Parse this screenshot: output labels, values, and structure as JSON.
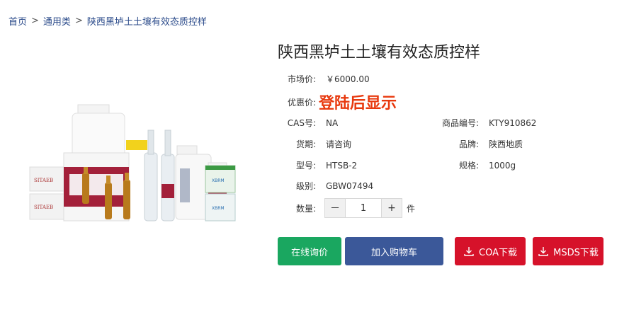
{
  "breadcrumb": {
    "items": [
      "首页",
      "通用类",
      "陕西黑垆土土壤有效态质控样"
    ],
    "separator": ">"
  },
  "product": {
    "title": "陕西黑垆土土壤有效态质控样",
    "market_price_label": "市场价:",
    "market_price_value": "￥6000.00",
    "promo_label": "优惠价:",
    "promo_value": "登陆后显示",
    "cas_label": "CAS号:",
    "cas_value": "NA",
    "code_label": "商品编号:",
    "code_value": "KTY910862",
    "delivery_label": "货期:",
    "delivery_value": "请咨询",
    "brand_label": "品牌:",
    "brand_value": "陕西地质",
    "model_label": "型号:",
    "model_value": "HTSB-2",
    "spec_label": "规格:",
    "spec_value": "1000g",
    "grade_label": "级别:",
    "grade_value": "GBW07494",
    "qty_label": "数量:",
    "qty_value": "1",
    "qty_minus": "－",
    "qty_plus": "+",
    "qty_unit": "件"
  },
  "actions": {
    "inquiry": "在线询价",
    "add_cart": "加入购物车",
    "coa": "COA下载",
    "msds": "MSDS下载"
  },
  "image_text": {
    "brand_left": "SITAEB",
    "brand_box": "XBRM"
  },
  "colors": {
    "promo": "#e8380d",
    "green": "#1aa760",
    "blue": "#3b5899",
    "red": "#d6122a",
    "breadcrumb": "#2a4a8a"
  }
}
